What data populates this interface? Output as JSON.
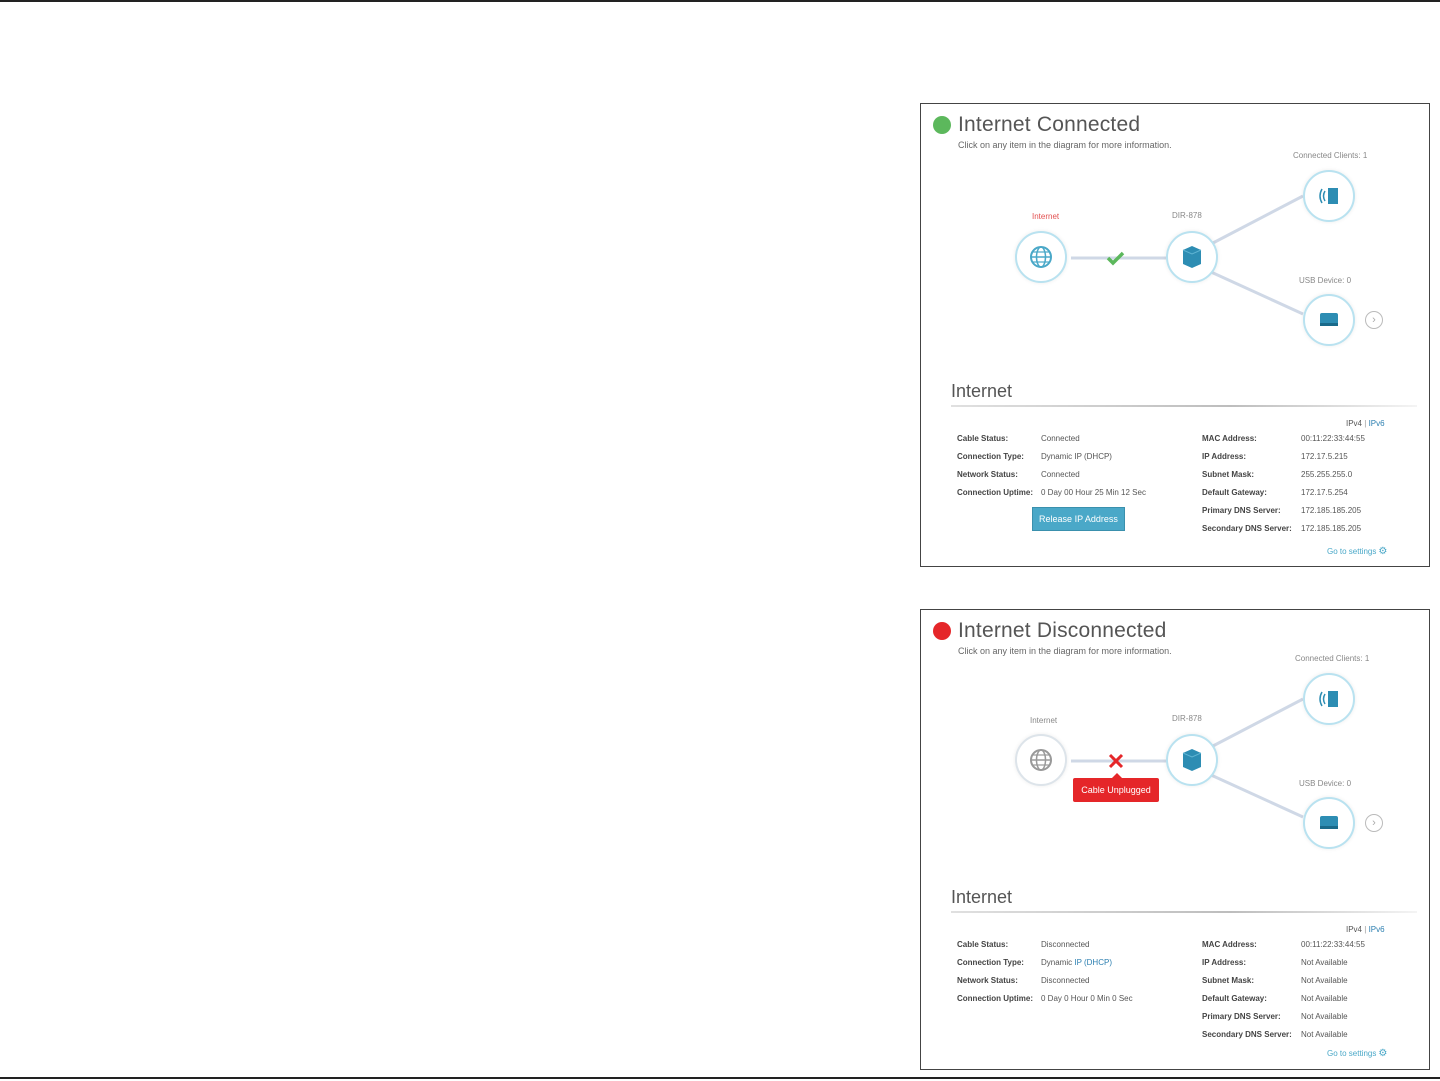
{
  "colors": {
    "connected": "#5cb85c",
    "disconnected": "#e52629",
    "accent": "#4aa8c8",
    "link": "#2c7fb0"
  },
  "connected_panel": {
    "title": "Internet Connected",
    "subtitle": "Click on any item in the diagram for more information.",
    "diagram": {
      "internet_label": "Internet",
      "router_label": "DIR-878",
      "clients_label": "Connected Clients: 1",
      "usb_label": "USB Device: 0",
      "link_status": "check-icon"
    },
    "section_title": "Internet",
    "ip_toggle": {
      "v4": "IPv4",
      "sep": "|",
      "v6": "IPv6"
    },
    "left_rows": [
      {
        "label": "Cable Status:",
        "value": "Connected"
      },
      {
        "label": "Connection Type:",
        "value": "Dynamic IP (DHCP)"
      },
      {
        "label": "Network Status:",
        "value": "Connected"
      },
      {
        "label": "Connection Uptime:",
        "value": "0 Day 00 Hour 25 Min 12 Sec"
      }
    ],
    "right_rows": [
      {
        "label": "MAC Address:",
        "value": "00:11:22:33:44:55"
      },
      {
        "label": "IP Address:",
        "value": "172.17.5.215"
      },
      {
        "label": "Subnet Mask:",
        "value": "255.255.255.0"
      },
      {
        "label": "Default Gateway:",
        "value": "172.17.5.254"
      },
      {
        "label": "Primary DNS Server:",
        "value": "172.185.185.205"
      },
      {
        "label": "Secondary DNS Server:",
        "value": "172.185.185.205"
      }
    ],
    "renew_button": "Release IP Address",
    "go_settings": "Go to settings"
  },
  "disconnected_panel": {
    "title": "Internet Disconnected",
    "subtitle": "Click on any item in the diagram for more information.",
    "diagram": {
      "internet_label": "Internet",
      "router_label": "DIR-878",
      "clients_label": "Connected Clients: 1",
      "usb_label": "USB Device: 0",
      "link_status": "cross-icon",
      "error_badge": "Cable Unplugged"
    },
    "section_title": "Internet",
    "ip_toggle": {
      "v4": "IPv4",
      "sep": "|",
      "v6": "IPv6"
    },
    "left_rows": [
      {
        "label": "Cable Status:",
        "value": "Disconnected"
      },
      {
        "label": "Connection Type:",
        "value_prefix": "Dynamic ",
        "value_link": "IP (DHCP)"
      },
      {
        "label": "Network Status:",
        "value": "Disconnected"
      },
      {
        "label": "Connection Uptime:",
        "value": "0 Day 0 Hour 0 Min 0 Sec"
      }
    ],
    "right_rows": [
      {
        "label": "MAC Address:",
        "value": "00:11:22:33:44:55"
      },
      {
        "label": "IP Address:",
        "value": "Not Available"
      },
      {
        "label": "Subnet Mask:",
        "value": "Not Available"
      },
      {
        "label": "Default Gateway:",
        "value": "Not Available"
      },
      {
        "label": "Primary DNS Server:",
        "value": "Not Available"
      },
      {
        "label": "Secondary DNS Server:",
        "value": "Not Available"
      }
    ],
    "go_settings": "Go to settings"
  }
}
